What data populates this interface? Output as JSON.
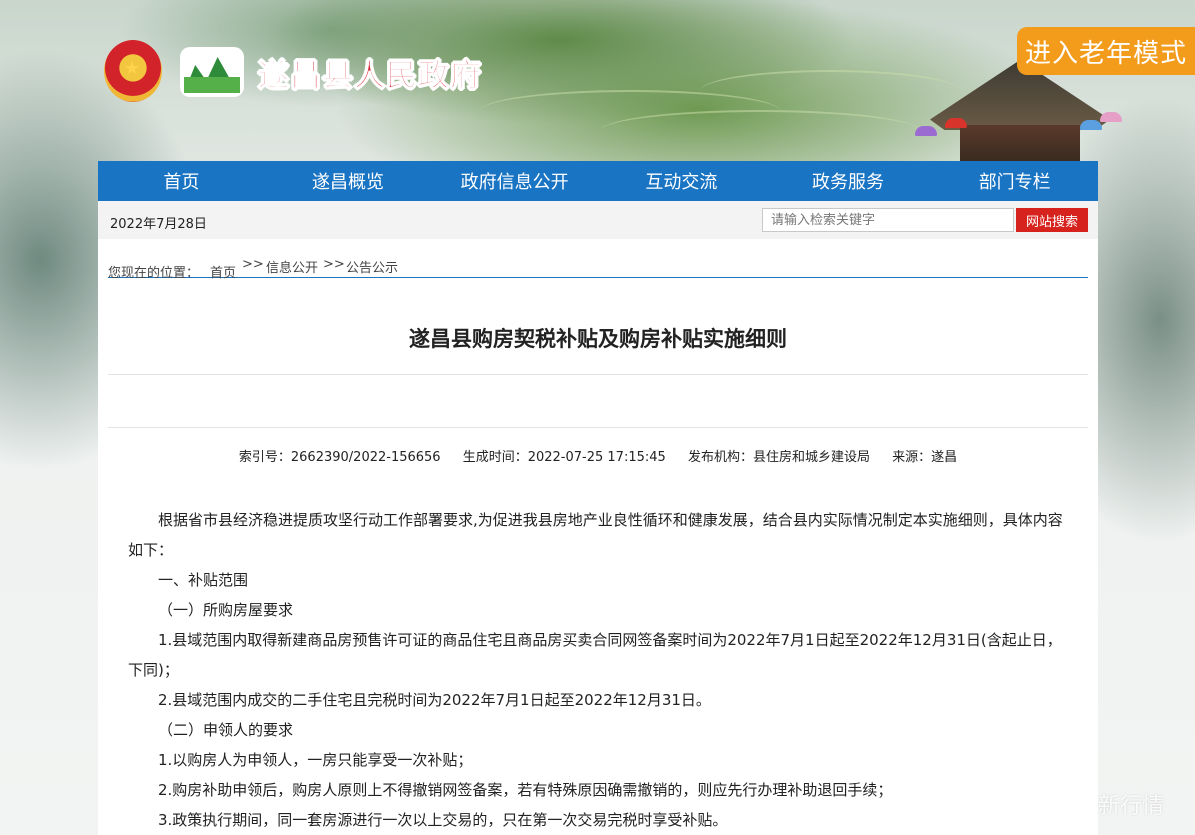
{
  "header": {
    "site_title": "遂昌县人民政府",
    "elder_mode_label": "进入老年模式",
    "emblem_icon": "national-emblem-icon",
    "county_logo_icon": "mountain-logo-icon"
  },
  "nav": {
    "items": [
      {
        "label": "首页"
      },
      {
        "label": "遂昌概览"
      },
      {
        "label": "政府信息公开"
      },
      {
        "label": "互动交流"
      },
      {
        "label": "政务服务"
      },
      {
        "label": "部门专栏"
      }
    ]
  },
  "topbar": {
    "date": "2022年7月28日",
    "search_placeholder": "请输入检索关键字",
    "search_button": "网站搜索"
  },
  "breadcrumb": {
    "prefix": "您现在的位置：",
    "home": "首页",
    "sep1": ">>",
    "level1": "信息公开",
    "sep2": ">>",
    "level2": "公告公示"
  },
  "article": {
    "title": "遂昌县购房契税补贴及购房补贴实施细则",
    "meta": {
      "index_no": "索引号：2662390/2022-156656",
      "created": "生成时间：2022-07-25 17:15:45",
      "publisher": "发布机构：县住房和城乡建设局",
      "source": "来源：遂昌"
    },
    "paragraphs": [
      "根据省市县经济稳进提质攻坚行动工作部署要求,为促进我县房地产业良性循环和健康发展，结合县内实际情况制定本实施细则，具体内容如下：",
      "一、补贴范围",
      "（一）所购房屋要求",
      "1.县域范围内取得新建商品房预售许可证的商品住宅且商品房买卖合同网签备案时间为2022年7月1日起至2022年12月31日(含起止日，下同)；",
      "2.县域范围内成交的二手住宅且完税时间为2022年7月1日起至2022年12月31日。",
      "（二）申领人的要求",
      "1.以购房人为申领人，一房只能享受一次补贴；",
      "2.购房补助申领后，购房人原则上不得撤销网签备案，若有特殊原因确需撤销的，则应先行办理补助退回手续；",
      "3.政策执行期间，同一套房源进行一次以上交易的，只在第一次交易完税时享受补贴。"
    ]
  },
  "watermark": "新行情",
  "colors": {
    "nav_bg": "#1974c4",
    "search_button_bg": "#d7231e",
    "elder_button_bg": "#f39b1b",
    "title_red": "#d8202a"
  }
}
